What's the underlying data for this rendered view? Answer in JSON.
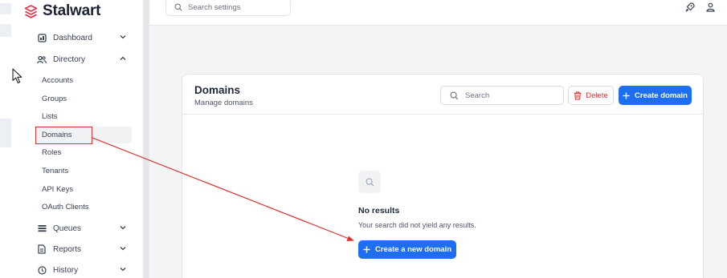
{
  "app": {
    "name": "Stalwart"
  },
  "topbar": {
    "search_placeholder": "Search settings",
    "icons": [
      "rocket-icon",
      "user-icon"
    ]
  },
  "sidebar": {
    "dashboard": "Dashboard",
    "directory": "Directory",
    "directory_items": [
      "Accounts",
      "Groups",
      "Lists",
      "Domains",
      "Roles",
      "Tenants",
      "API Keys",
      "OAuth Clients"
    ],
    "active_item": "Domains",
    "queues": "Queues",
    "reports": "Reports",
    "history": "History"
  },
  "card": {
    "title": "Domains",
    "subtitle": "Manage domains",
    "search_placeholder": "Search",
    "delete_label": "Delete",
    "create_label": "Create domain"
  },
  "empty_state": {
    "title": "No results",
    "text": "Your search did not yield any results.",
    "button_label": "Create a new domain"
  },
  "colors": {
    "accent": "#1d6ef0",
    "danger": "#e03131",
    "annotation": "#e03131"
  }
}
